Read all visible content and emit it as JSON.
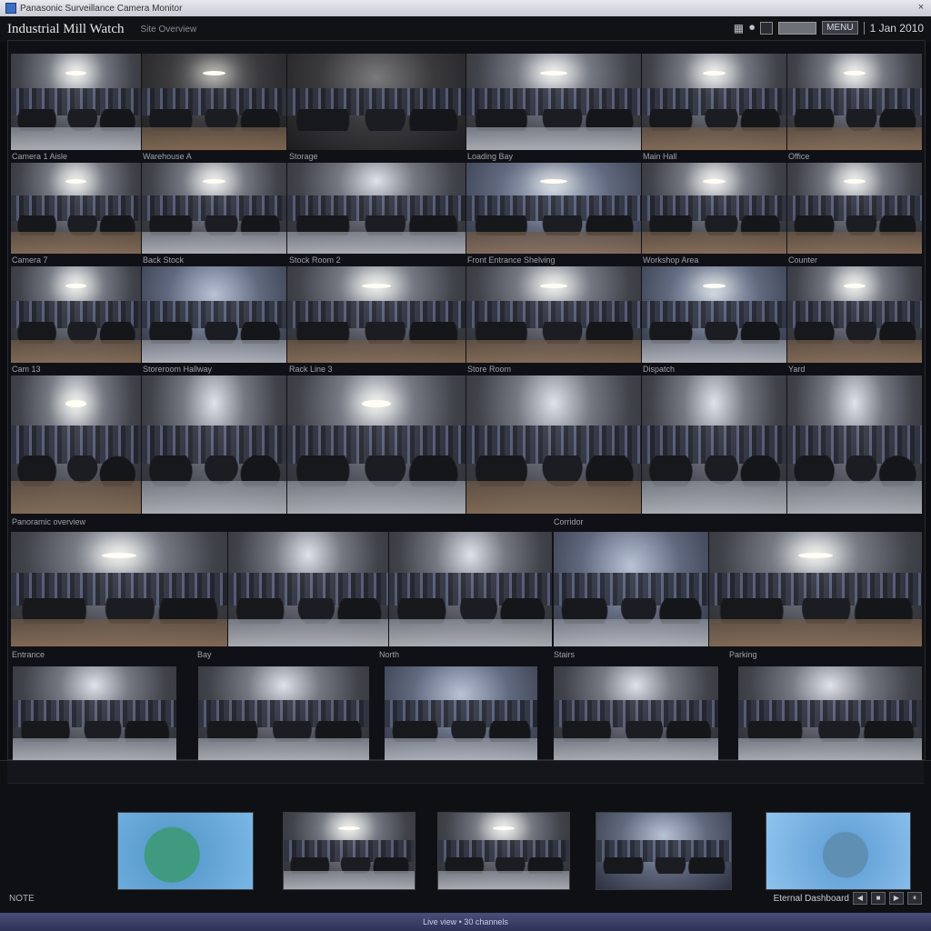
{
  "window": {
    "title": "Panasonic Surveillance Camera Monitor",
    "close_label": "×"
  },
  "header": {
    "app_name": "Industrial Mill Watch",
    "subtitle": "Site Overview",
    "controls": {
      "grid_icon": "▦",
      "record_icon": "⏺",
      "menu_label": "MENU",
      "date": "1 Jan 2010"
    }
  },
  "grid": {
    "row_labels": [
      [
        "Camera 1 Aisle",
        "Warehouse A",
        "Storage",
        "Loading Bay",
        "Main Hall",
        "Office"
      ],
      [
        "Camera 7",
        "Back Stock",
        "Stock Room 2",
        "Front Entrance Shelving",
        "Workshop Area",
        "Counter"
      ],
      [
        "Cam 13",
        "Storeroom Hallway",
        "Rack Line 3",
        "Store Room",
        "Dispatch",
        "Yard"
      ],
      [
        "Panoramic overview",
        "Corridor"
      ],
      [
        "Entrance",
        "Bay",
        "North",
        "Stairs",
        "Parking"
      ]
    ]
  },
  "strip": {
    "left_label": "NOTE",
    "right_label": "Eternal Dashboard",
    "buttons": [
      "◀",
      "■",
      "▶",
      "⏸"
    ]
  },
  "status": {
    "text": "Live view • 30 channels"
  },
  "icons": {
    "app": "app-icon",
    "close": "close-icon",
    "grid": "grid-icon",
    "record": "record-icon",
    "prev": "prev-icon",
    "stop": "stop-icon",
    "play": "play-icon",
    "pause": "pause-icon"
  },
  "colors": {
    "statusbar": "#2d3158",
    "background": "#0b0c10"
  }
}
